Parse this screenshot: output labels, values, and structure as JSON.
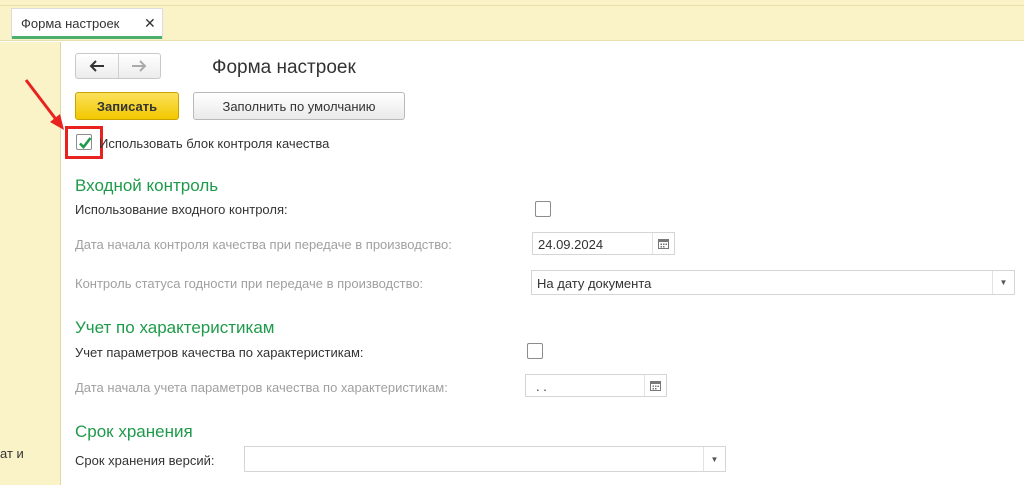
{
  "tab": {
    "label": "Форма настроек",
    "close": "✕"
  },
  "left_panel": {
    "text": "ат и"
  },
  "form": {
    "title": "Форма настроек",
    "save_label": "Записать",
    "fill_default_label": "Заполнить по умолчанию",
    "use_quality_block": {
      "label": "Использовать блок контроля качества",
      "checked": true
    }
  },
  "sections": {
    "input_control": {
      "title": "Входной контроль",
      "use_input_control_label": "Использование входного контроля:",
      "start_date_label": "Дата начала контроля качества при передаче в производство:",
      "start_date_value": "24.09.2024",
      "status_label": "Контроль статуса годности при передаче в производство:",
      "status_value": "На дату документа"
    },
    "characteristics": {
      "title": "Учет по характеристикам",
      "params_label": "Учет параметров качества по характеристикам:",
      "start_date_label": "Дата начала учета параметров качества по характеристикам:",
      "start_date_value": " .  ."
    },
    "storage": {
      "title": "Срок хранения",
      "versions_label": "Срок хранения версий:",
      "versions_value": ""
    }
  },
  "colors": {
    "accent_green": "#1e9a4a",
    "save_yellow": "#f2c800",
    "highlight_red": "#e8231f",
    "panel_yellow": "#fbf3c8"
  },
  "icons": {
    "back": "arrow-left-icon",
    "forward": "arrow-right-icon",
    "calendar": "calendar-icon",
    "dropdown": "chevron-down-icon",
    "check": "checkmark-icon"
  }
}
